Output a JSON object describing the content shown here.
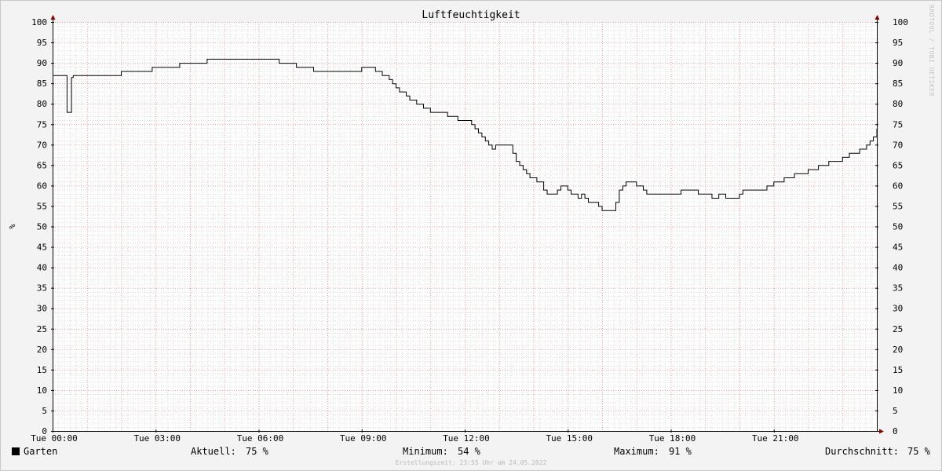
{
  "chart_data": {
    "type": "line",
    "title": "Luftfeuchtigkeit",
    "ylabel": "%",
    "xlabel": "",
    "ylim": [
      0,
      100
    ],
    "yticks": [
      0,
      5,
      10,
      15,
      20,
      25,
      30,
      35,
      40,
      45,
      50,
      55,
      60,
      65,
      70,
      75,
      80,
      85,
      90,
      95,
      100
    ],
    "xlim": [
      0,
      24
    ],
    "xticks": [
      {
        "x": 0,
        "label": "Tue 00:00"
      },
      {
        "x": 3,
        "label": "Tue 03:00"
      },
      {
        "x": 6,
        "label": "Tue 06:00"
      },
      {
        "x": 9,
        "label": "Tue 09:00"
      },
      {
        "x": 12,
        "label": "Tue 12:00"
      },
      {
        "x": 15,
        "label": "Tue 15:00"
      },
      {
        "x": 18,
        "label": "Tue 18:00"
      },
      {
        "x": 21,
        "label": "Tue 21:00"
      }
    ],
    "grid": true,
    "series": [
      {
        "name": "Garten",
        "color": "#000000",
        "x": [
          0,
          0.4,
          0.42,
          0.44,
          0.54,
          0.55,
          0.6,
          0.7,
          1.3,
          2.0,
          2.9,
          3.7,
          4.5,
          5.1,
          6.1,
          6.6,
          7.1,
          7.6,
          8.1,
          8.5,
          9.0,
          9.3,
          9.4,
          9.6,
          9.8,
          9.9,
          10.0,
          10.1,
          10.3,
          10.4,
          10.6,
          10.8,
          11.0,
          11.5,
          11.8,
          12.2,
          12.3,
          12.4,
          12.5,
          12.6,
          12.7,
          12.8,
          12.9,
          13.0,
          13.1,
          13.4,
          13.5,
          13.6,
          13.7,
          13.8,
          13.9,
          14.0,
          14.1,
          14.3,
          14.4,
          14.6,
          14.7,
          14.8,
          15.0,
          15.1,
          15.3,
          15.4,
          15.5,
          15.6,
          15.9,
          16.0,
          16.1,
          16.4,
          16.5,
          16.6,
          16.7,
          16.9,
          17.0,
          17.2,
          17.3,
          17.8,
          18.3,
          18.7,
          18.8,
          19.0,
          19.2,
          19.4,
          19.6,
          20.0,
          20.1,
          20.4,
          20.8,
          21.0,
          21.3,
          21.6,
          22.0,
          22.3,
          22.6,
          23.0,
          23.2,
          23.5,
          23.7,
          23.8,
          23.9,
          24.0
        ],
        "values": [
          87,
          87,
          78,
          78,
          78,
          86.5,
          87,
          87,
          87,
          88,
          89,
          90,
          91,
          91,
          91,
          90,
          89,
          88,
          88,
          88,
          89,
          89,
          88,
          87,
          86,
          85,
          84,
          83,
          82,
          81,
          80,
          79,
          78,
          77,
          76,
          75,
          74,
          73,
          72,
          71,
          70,
          69,
          70,
          70,
          70,
          68,
          66,
          65,
          64,
          63,
          62,
          62,
          61,
          59,
          58,
          58,
          59,
          60,
          59,
          58,
          57,
          58,
          57,
          56,
          55,
          54,
          54,
          56,
          59,
          60,
          61,
          61,
          60,
          59,
          58,
          58,
          59,
          59,
          58,
          58,
          57,
          58,
          57,
          58,
          59,
          59,
          60,
          61,
          62,
          63,
          64,
          65,
          66,
          67,
          68,
          69,
          70,
          71,
          72,
          74
        ]
      }
    ]
  },
  "legend": {
    "series_name": "Garten",
    "aktuell_label": "Aktuell:",
    "aktuell_value": "75 %",
    "minimum_label": "Minimum:",
    "minimum_value": "54 %",
    "maximum_label": "Maximum:",
    "maximum_value": "91 %",
    "durchschnitt_label": "Durchschnitt:",
    "durchschnitt_value": "75 %"
  },
  "footer": {
    "creation_time": "Erstellungszeit: 23:55 Uhr am 24.05.2022"
  },
  "vendor": {
    "text": "RRDTOOL / TOBI OETIKER"
  },
  "colors": {
    "background": "#f3f3f3",
    "plot_background": "#ffffff",
    "minor_grid": "#c8c8c8",
    "major_grid": "#e08080",
    "axis": "#000000",
    "arrow": "#8b0000"
  }
}
